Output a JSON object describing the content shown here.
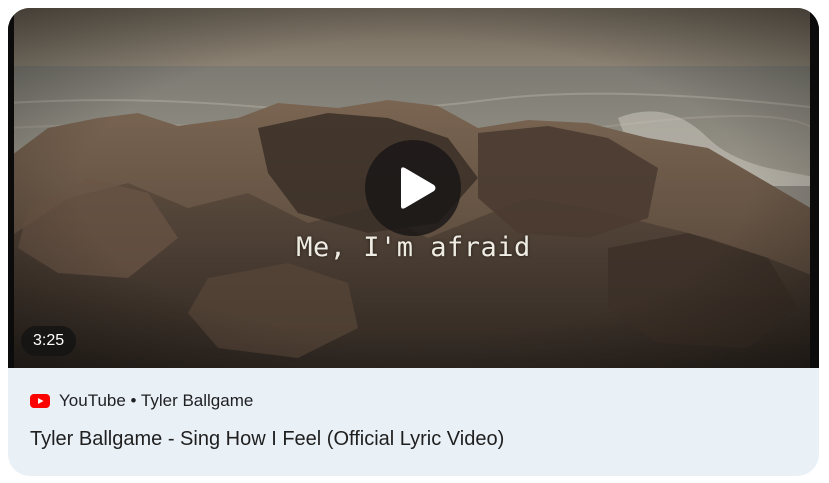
{
  "video": {
    "overlay_text": "Me, I'm afraid",
    "duration": "3:25",
    "play_icon": "play-icon"
  },
  "source": {
    "platform_icon": "youtube-icon",
    "platform": "YouTube",
    "separator": "•",
    "channel": "Tyler Ballgame",
    "line": "YouTube • Tyler Ballgame"
  },
  "title": "Tyler Ballgame - Sing How I Feel (Official Lyric Video)",
  "colors": {
    "card_background": "#e9f0f6",
    "youtube_red": "#ff0000",
    "title_text": "#1f1f1f"
  }
}
